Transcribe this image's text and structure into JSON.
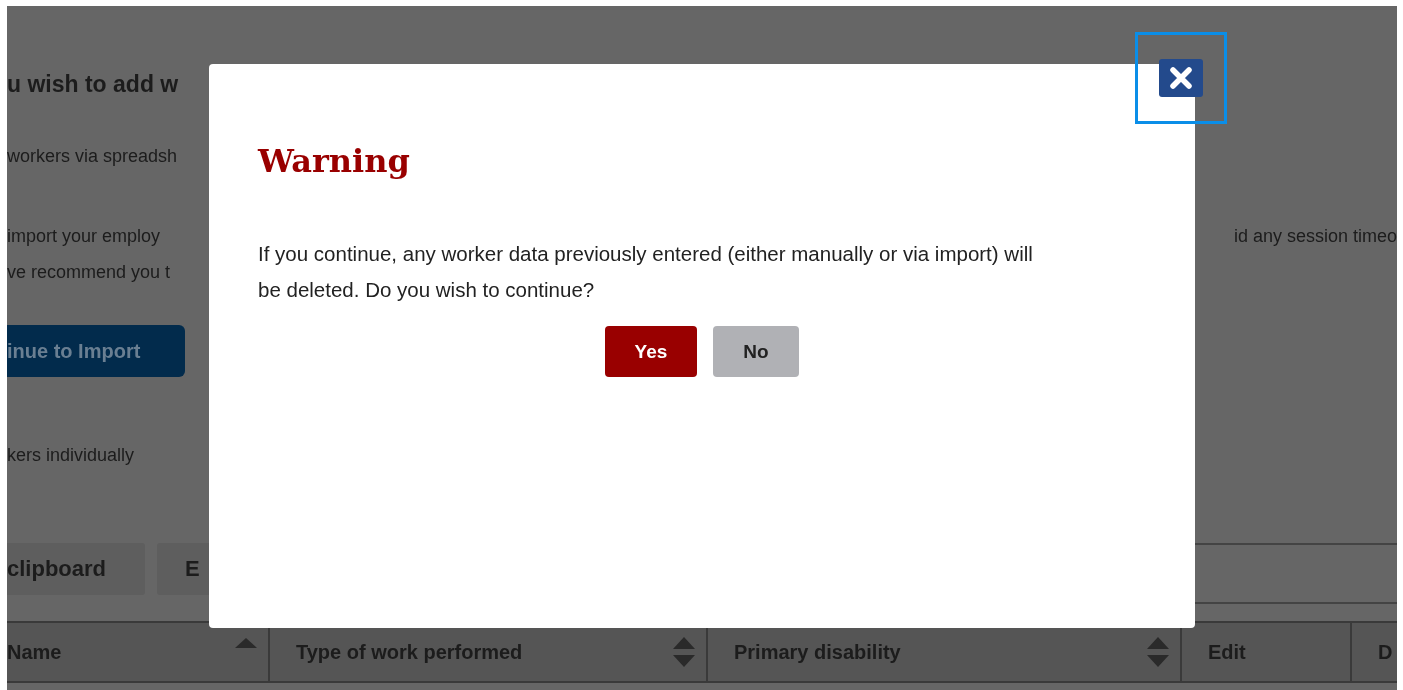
{
  "background": {
    "heading": "u wish to add w",
    "paragraphs": [
      {
        "left": "workers via spreadsh"
      },
      {
        "left": "import your employ",
        "right": "id any session timeo"
      },
      {
        "left": "ve recommend you t"
      }
    ],
    "import_button": "inue to Import",
    "individual_text": "kers individually",
    "toolbar_buttons": [
      "clipboard",
      "E"
    ],
    "table": {
      "columns": [
        {
          "label": "Name",
          "sortable": true,
          "sorted": true
        },
        {
          "label": "Type of work performed",
          "sortable": true,
          "sorted": false
        },
        {
          "label": "Primary disability",
          "sortable": true,
          "sorted": false
        },
        {
          "label": "Edit"
        },
        {
          "label": "D"
        }
      ]
    }
  },
  "modal": {
    "title": "Warning",
    "message": "If you continue, any worker data previously entered (either manually or via import) will be deleted. Do you wish to continue?",
    "close_focused": true,
    "buttons": [
      {
        "label": "Yes",
        "kind": "primary"
      },
      {
        "label": "No",
        "kind": "secondary"
      }
    ]
  }
}
